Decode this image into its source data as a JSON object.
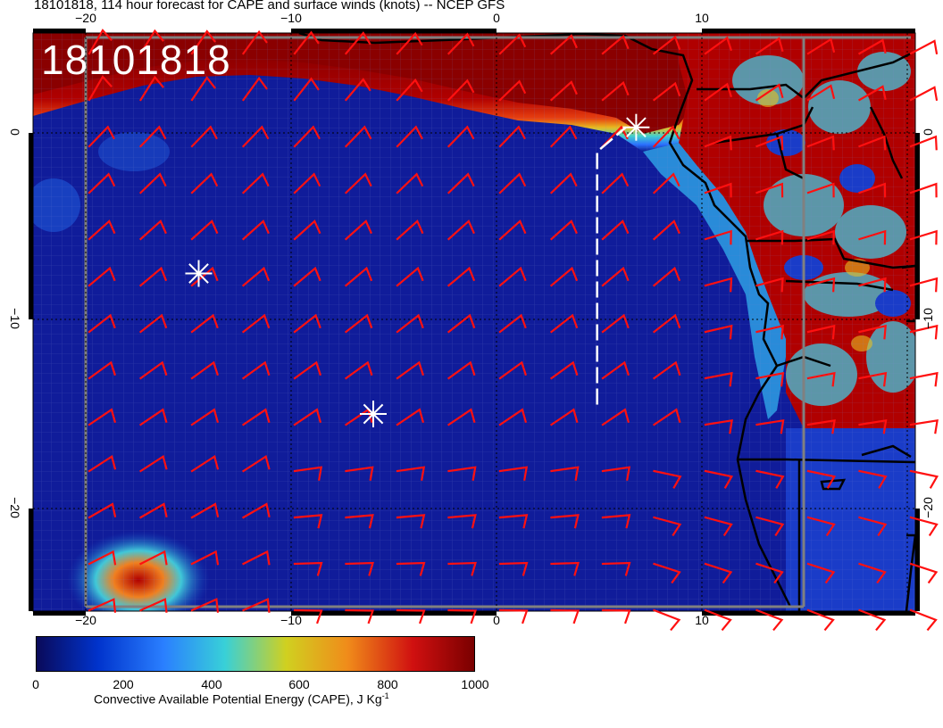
{
  "title": "18101818, 114 hour forecast for CAPE and surface winds (knots) -- NCEP GFS",
  "map_stamp": "18101818",
  "axes": {
    "x_ticks_top": [
      "−20",
      "−10",
      "0",
      "10"
    ],
    "x_ticks_bottom": [
      "−20",
      "−10",
      "0",
      "10"
    ],
    "y_ticks_left": [
      "0",
      "−10",
      "−20"
    ],
    "y_ticks_right": [
      "0",
      "−10",
      "−20"
    ]
  },
  "map": {
    "region": "Gulf of Guinea / Southeast Atlantic with west-central African coast",
    "lon_range": [
      -22.5,
      20.5
    ],
    "lat_range": [
      -25,
      5
    ],
    "markers": [
      {
        "lon": -14.5,
        "lat": -7.5
      },
      {
        "lon": -6.0,
        "lat": -15.0
      },
      {
        "lon": 6.8,
        "lat": 0.3
      }
    ],
    "track": [
      [
        4.9,
        -14.5
      ],
      [
        4.9,
        -1.0
      ],
      [
        6.3,
        0.3
      ]
    ],
    "wind_barb_color": "#ff0000",
    "marker_color": "#ffffff",
    "track_color": "#ffffff"
  },
  "colorbar": {
    "label_main": "Convective Available Potential Energy (CAPE), J Kg",
    "label_sup": "-1",
    "ticks": [
      "0",
      "200",
      "400",
      "600",
      "800",
      "1000"
    ],
    "range": [
      0,
      1000
    ],
    "colors": [
      "#0a0a5a",
      "#0033cc",
      "#2a7fff",
      "#38d0d8",
      "#d0d020",
      "#f08c1a",
      "#d01010",
      "#7a0000"
    ]
  }
}
